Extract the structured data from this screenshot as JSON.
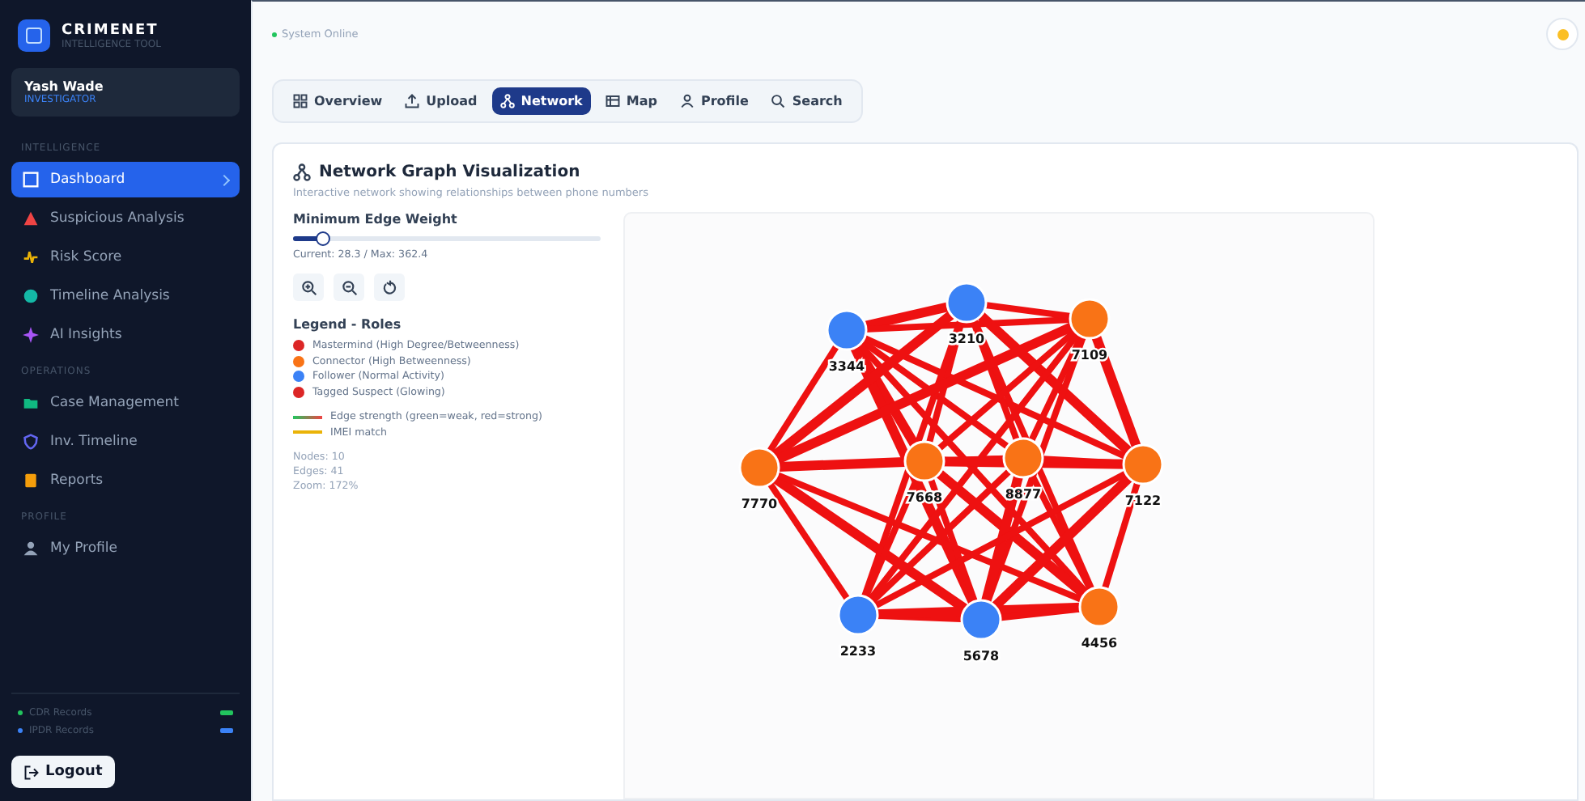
{
  "brand": {
    "name": "CRIMENET",
    "subtitle": "INTELLIGENCE TOOL"
  },
  "user": {
    "name": "Yash Wade",
    "role": "INVESTIGATOR"
  },
  "sidebar": {
    "sections": [
      {
        "title": "INTELLIGENCE",
        "items": [
          {
            "label": "Dashboard",
            "selected": true
          },
          {
            "label": "Suspicious Analysis",
            "selected": false
          },
          {
            "label": "Risk Score",
            "selected": false
          },
          {
            "label": "Timeline Analysis",
            "selected": false
          },
          {
            "label": "AI Insights",
            "selected": false
          }
        ]
      },
      {
        "title": "OPERATIONS",
        "items": [
          {
            "label": "Case Management",
            "selected": false
          },
          {
            "label": "Inv. Timeline",
            "selected": false
          },
          {
            "label": "Reports",
            "selected": false
          }
        ]
      },
      {
        "title": "PROFILE",
        "items": [
          {
            "label": "My Profile",
            "selected": false
          }
        ]
      }
    ],
    "records": [
      {
        "label": "CDR Records",
        "color": "#22c55e"
      },
      {
        "label": "IPDR Records",
        "color": "#3b82f6"
      }
    ],
    "logout": "Logout"
  },
  "status": {
    "label": "System Online"
  },
  "tabs": [
    {
      "label": "Overview",
      "selected": false
    },
    {
      "label": "Upload",
      "selected": false
    },
    {
      "label": "Network",
      "selected": true
    },
    {
      "label": "Map",
      "selected": false
    },
    {
      "label": "Profile",
      "selected": false
    },
    {
      "label": "Search",
      "selected": false
    }
  ],
  "panel": {
    "title": "Network Graph Visualization",
    "subtitle": "Interactive network showing relationships between phone numbers",
    "slider": {
      "label": "Minimum Edge Weight",
      "level": 0.1,
      "reading": "Current: 28.3 / Max: 362.4"
    },
    "legend_title": "Legend - Roles",
    "legend": [
      {
        "label": "Mastermind (High Degree/Betweenness)",
        "color": "#dc2626"
      },
      {
        "label": "Connector (High Betweenness)",
        "color": "#f97316"
      },
      {
        "label": "Follower (Normal Activity)",
        "color": "#3b82f6"
      },
      {
        "label": "Tagged Suspect (Glowing)",
        "color": "#dc2626"
      }
    ],
    "edge_legend": [
      {
        "label": "Edge strength (green=weak, red=strong)",
        "kind": "gradient"
      },
      {
        "label": "IMEI match",
        "kind": "imei"
      }
    ],
    "stats": [
      "Nodes: 10",
      "Edges: 41",
      "Zoom: 172%"
    ],
    "nodes": [
      {
        "label": "3344",
        "color": "#3b82f6"
      },
      {
        "label": "3210",
        "color": "#3b82f6"
      },
      {
        "label": "7109",
        "color": "#f97316"
      },
      {
        "label": "7770",
        "color": "#f97316"
      },
      {
        "label": "7668",
        "color": "#f97316"
      },
      {
        "label": "8877",
        "color": "#f97316"
      },
      {
        "label": "7122",
        "color": "#f97316"
      },
      {
        "label": "2233",
        "color": "#3b82f6"
      },
      {
        "label": "5678",
        "color": "#3b82f6"
      },
      {
        "label": "4456",
        "color": "#f97316"
      }
    ]
  }
}
